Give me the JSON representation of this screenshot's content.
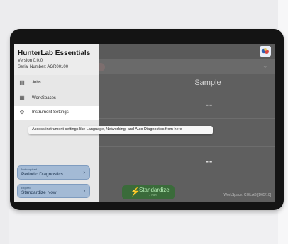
{
  "app": {
    "name": "HunterLab Essentials",
    "version": "Version 0.0.0",
    "serial": "Serial Number: AGR00100"
  },
  "nav": {
    "items": [
      {
        "label": "Jobs",
        "icon": "document-icon"
      },
      {
        "label": "WorkSpaces",
        "icon": "workspaces-icon"
      },
      {
        "label": "Instrument Settings",
        "icon": "gear-icon"
      }
    ],
    "tooltip": "Access instrument settings like Language, Networking, and Auto Diagnostics from here"
  },
  "actions": [
    {
      "sup": "Not required",
      "title": "Periodic Diagnostics"
    },
    {
      "sup": "Expired",
      "title": "Standardize Now"
    }
  ],
  "main": {
    "sample_title": "Sample",
    "values": [
      "--",
      "--",
      "--"
    ],
    "standardize_label": "Standardize",
    "standardize_sub": "7 Port",
    "workspace_status": "WorkSpace: CIELAB [D65/10]"
  },
  "colors": {
    "drawer_bg": "#e7e7e7",
    "active_item": "#ffffff",
    "action_card": "#a3bad5",
    "standardize_button": "#3a6b3a"
  }
}
